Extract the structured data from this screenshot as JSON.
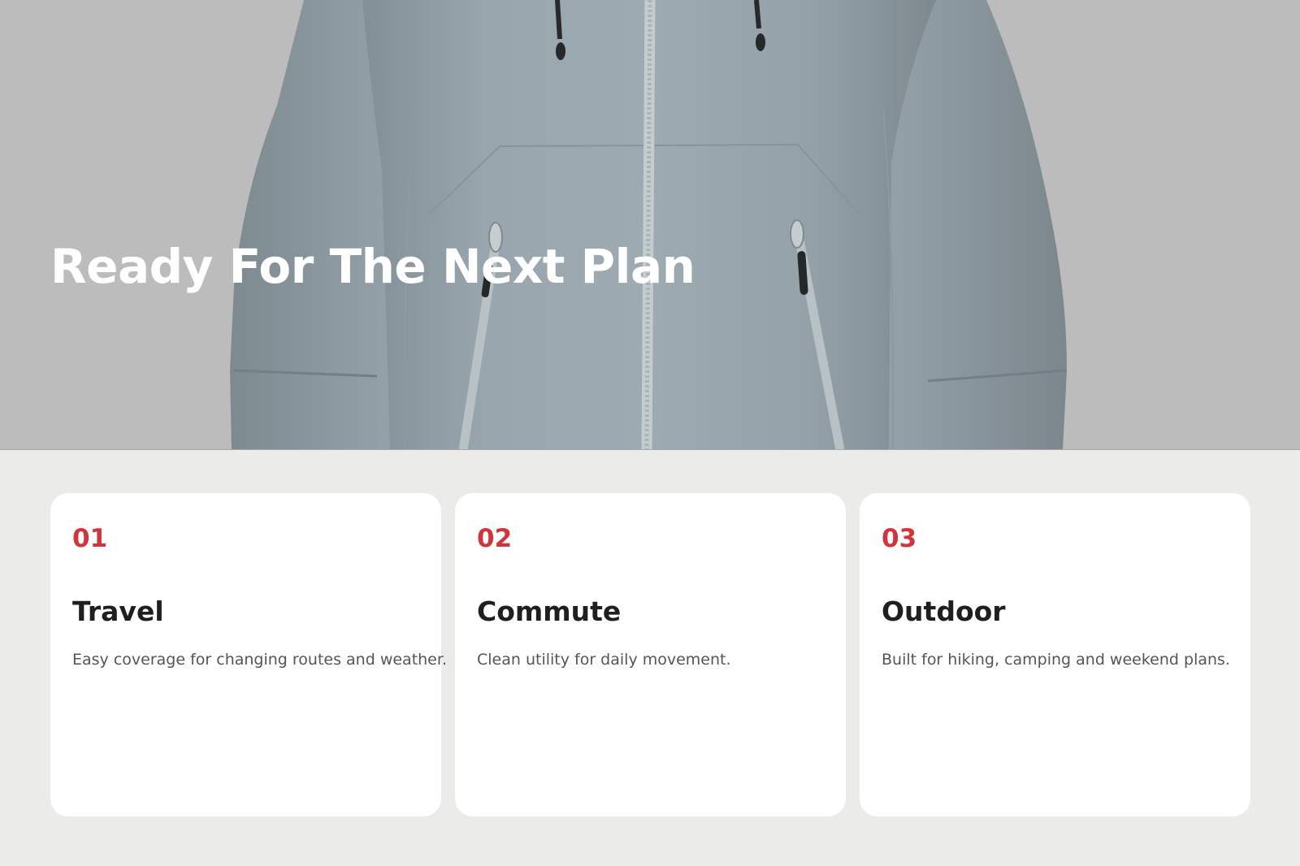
{
  "hero": {
    "title": "Ready For The Next Plan",
    "image_subject": "jacket-image"
  },
  "cards": [
    {
      "number": "01",
      "title": "Travel",
      "description": "Easy coverage for changing routes and weather."
    },
    {
      "number": "02",
      "title": "Commute",
      "description": "Clean utility for daily movement."
    },
    {
      "number": "03",
      "title": "Outdoor",
      "description": "Built for hiking, camping and weekend plans."
    }
  ],
  "colors": {
    "hero_background": "#bcbcbc",
    "page_background": "#ebebe9",
    "card_background": "#ffffff",
    "accent": "#d3333a",
    "jacket": "#9aa6ad",
    "title_text": "#1f1f1f",
    "body_text": "#555555"
  }
}
